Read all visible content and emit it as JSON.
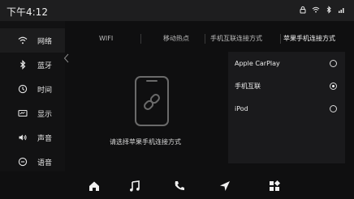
{
  "status": {
    "time": "下午4:12",
    "icons": [
      "lock-icon",
      "wifi-icon",
      "bluetooth-icon",
      "signal-icon"
    ]
  },
  "sidebar": {
    "items": [
      {
        "label": "网络",
        "icon": "wifi-icon",
        "active": true
      },
      {
        "label": "蓝牙",
        "icon": "bluetooth-icon",
        "active": false
      },
      {
        "label": "时间",
        "icon": "clock-icon",
        "active": false
      },
      {
        "label": "显示",
        "icon": "display-icon",
        "active": false
      },
      {
        "label": "声音",
        "icon": "speaker-icon",
        "active": false
      },
      {
        "label": "语音",
        "icon": "voice-icon",
        "active": false
      }
    ]
  },
  "tabs": [
    {
      "label": "WIFI",
      "active": false
    },
    {
      "label": "移动热点",
      "active": false
    },
    {
      "label": "手机互联连接方式",
      "active": false
    },
    {
      "label": "苹果手机连接方式",
      "active": true
    }
  ],
  "content": {
    "hint": "请选择苹果手机连接方式",
    "illustration": "phone-link-icon"
  },
  "options": [
    {
      "label": "Apple CarPlay",
      "selected": false
    },
    {
      "label": "手机互联",
      "selected": true
    },
    {
      "label": "iPod",
      "selected": false
    }
  ],
  "bottom_nav": [
    {
      "icon": "home-icon"
    },
    {
      "icon": "music-icon"
    },
    {
      "icon": "phone-icon"
    },
    {
      "icon": "navigation-icon"
    },
    {
      "icon": "apps-icon"
    }
  ]
}
